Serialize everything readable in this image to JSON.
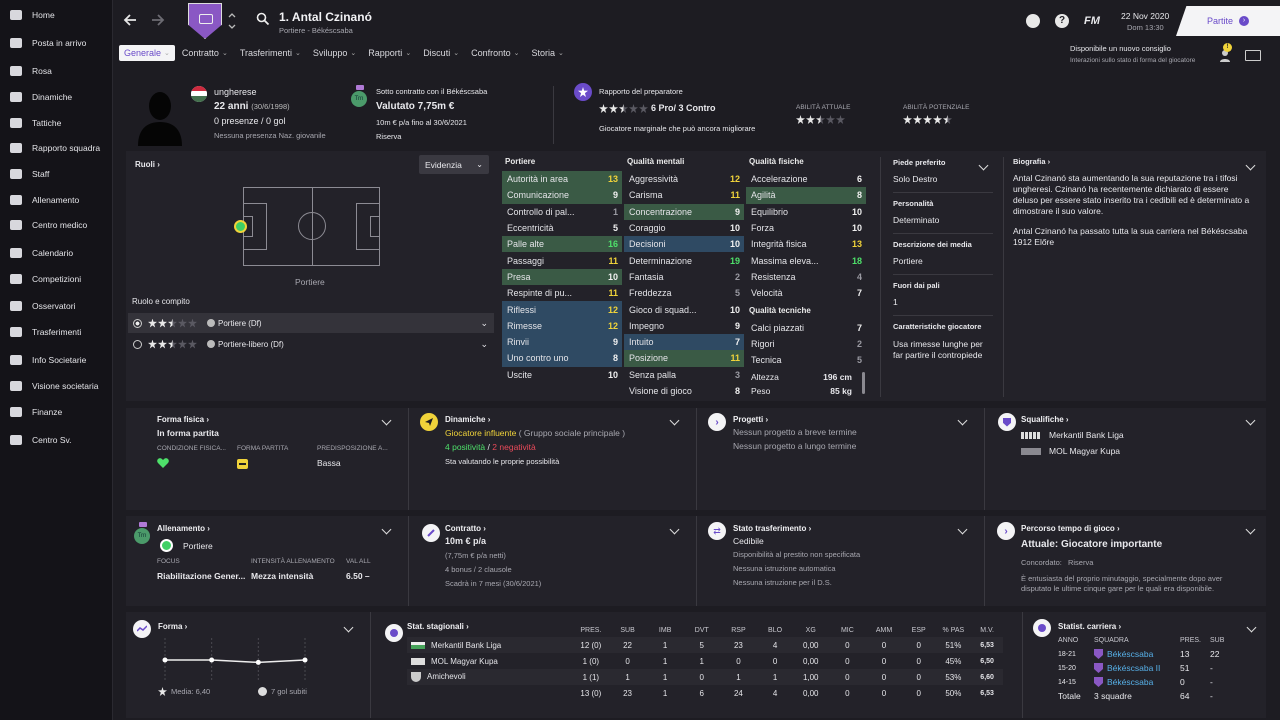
{
  "sidebar": {
    "items": [
      {
        "label": "Home",
        "icon": "home-icon"
      },
      {
        "label": "Posta in arrivo",
        "icon": "inbox-icon"
      },
      {
        "label": "Rosa",
        "icon": "shirt-icon"
      },
      {
        "label": "Dinamiche",
        "icon": "dynamics-icon"
      },
      {
        "label": "Tattiche",
        "icon": "tactics-icon"
      },
      {
        "label": "Rapporto squadra",
        "icon": "clipboard-icon"
      },
      {
        "label": "Staff",
        "icon": "staff-icon"
      },
      {
        "label": "Allenamento",
        "icon": "training-icon"
      },
      {
        "label": "Centro medico",
        "icon": "medical-icon"
      },
      {
        "label": "Calendario",
        "icon": "calendar-icon"
      },
      {
        "label": "Competizioni",
        "icon": "trophy-icon"
      },
      {
        "label": "Osservatori",
        "icon": "scout-icon"
      },
      {
        "label": "Trasferimenti",
        "icon": "transfer-icon"
      },
      {
        "label": "Info Societarie",
        "icon": "club-info-icon"
      },
      {
        "label": "Visione societaria",
        "icon": "vision-icon"
      },
      {
        "label": "Finanze",
        "icon": "finance-icon"
      },
      {
        "label": "Centro Sv.",
        "icon": "dev-centre-icon"
      }
    ]
  },
  "header": {
    "player_name": "1. Antal Czinanó",
    "subtitle": "Portiere - Békéscsaba",
    "date": "22 Nov 2020",
    "time": "Dom 13:30",
    "fm_logo": "FM",
    "continue_label": "Partite",
    "advice_title": "Disponibile un nuovo consiglio",
    "advice_sub": "Interazioni sullo stato di forma del giocatore",
    "advice_badge": "!"
  },
  "tabs": [
    {
      "label": "Generale",
      "active": true
    },
    {
      "label": "Contratto"
    },
    {
      "label": "Trasferimenti"
    },
    {
      "label": "Sviluppo"
    },
    {
      "label": "Rapporti"
    },
    {
      "label": "Discuti"
    },
    {
      "label": "Confronto"
    },
    {
      "label": "Storia"
    }
  ],
  "profile": {
    "nationality": "ungherese",
    "age": "22 anni",
    "dob": "(30/6/1998)",
    "caps": "0 presenze / 0 gol",
    "youth_caps": "Nessuna presenza Naz. giovanile",
    "contract_with": "Sotto contratto con il Békéscsaba",
    "value": "Valutato 7,75m €",
    "wage": "10m € p/a fino al 30/6/2021",
    "squad_status": "Riserva",
    "trn_badge": "Trn",
    "coach_report": "Rapporto del preparatore",
    "pros_cons": "6 Pro/ 3 Contro",
    "coach_summary": "Giocatore marginale che può ancora migliorare",
    "current_ability_label": "ABILITÀ ATTUALE",
    "potential_ability_label": "ABILITÀ POTENZIALE",
    "current_ability_stars": 2.5,
    "potential_ability_stars": 4.5
  },
  "roles": {
    "title": "Ruoli",
    "filter": "Evidenzia",
    "position_label": "Portiere",
    "role_duty_title": "Ruolo e compito",
    "items": [
      {
        "label": "Portiere (Df)",
        "stars": 2.5
      },
      {
        "label": "Portiere-libero (Df)",
        "stars": 2.5
      }
    ]
  },
  "attributes": {
    "goalkeeping_title": "Portiere",
    "mental_title": "Qualità mentali",
    "physical_title": "Qualità fisiche",
    "technical_title": "Qualità tecniche",
    "goalkeeping": [
      {
        "name": "Autorità in area",
        "value": "13",
        "hl": "g",
        "c": "yellow"
      },
      {
        "name": "Comunicazione",
        "value": "9",
        "hl": "g",
        "c": "white"
      },
      {
        "name": "Controllo di pal...",
        "value": "1",
        "hl": "",
        "c": "grey"
      },
      {
        "name": "Eccentricità",
        "value": "5",
        "hl": "",
        "c": "white"
      },
      {
        "name": "Palle alte",
        "value": "16",
        "hl": "g",
        "c": "green"
      },
      {
        "name": "Passaggi",
        "value": "11",
        "hl": "",
        "c": "yellow"
      },
      {
        "name": "Presa",
        "value": "10",
        "hl": "g",
        "c": "white"
      },
      {
        "name": "Respinte di pu...",
        "value": "11",
        "hl": "",
        "c": "yellow"
      },
      {
        "name": "Riflessi",
        "value": "12",
        "hl": "b",
        "c": "yellow"
      },
      {
        "name": "Rimesse",
        "value": "12",
        "hl": "b",
        "c": "yellow"
      },
      {
        "name": "Rinvii",
        "value": "9",
        "hl": "b",
        "c": "white"
      },
      {
        "name": "Uno contro uno",
        "value": "8",
        "hl": "b",
        "c": "white"
      },
      {
        "name": "Uscite",
        "value": "10",
        "hl": "",
        "c": "white"
      }
    ],
    "mental": [
      {
        "name": "Aggressività",
        "value": "12",
        "hl": "",
        "c": "yellow"
      },
      {
        "name": "Carisma",
        "value": "11",
        "hl": "",
        "c": "yellow"
      },
      {
        "name": "Concentrazione",
        "value": "9",
        "hl": "g",
        "c": "white"
      },
      {
        "name": "Coraggio",
        "value": "10",
        "hl": "",
        "c": "white"
      },
      {
        "name": "Decisioni",
        "value": "10",
        "hl": "b",
        "c": "white"
      },
      {
        "name": "Determinazione",
        "value": "19",
        "hl": "",
        "c": "green"
      },
      {
        "name": "Fantasia",
        "value": "2",
        "hl": "",
        "c": "grey"
      },
      {
        "name": "Freddezza",
        "value": "5",
        "hl": "",
        "c": "grey"
      },
      {
        "name": "Gioco di squad...",
        "value": "10",
        "hl": "",
        "c": "white"
      },
      {
        "name": "Impegno",
        "value": "9",
        "hl": "",
        "c": "white"
      },
      {
        "name": "Intuito",
        "value": "7",
        "hl": "b",
        "c": "white"
      },
      {
        "name": "Posizione",
        "value": "11",
        "hl": "g",
        "c": "yellow"
      },
      {
        "name": "Senza palla",
        "value": "3",
        "hl": "",
        "c": "grey"
      },
      {
        "name": "Visione di gioco",
        "value": "8",
        "hl": "",
        "c": "white"
      }
    ],
    "physical": [
      {
        "name": "Accelerazione",
        "value": "6",
        "hl": "",
        "c": "white"
      },
      {
        "name": "Agilità",
        "value": "8",
        "hl": "g",
        "c": "white"
      },
      {
        "name": "Equilibrio",
        "value": "10",
        "hl": "",
        "c": "white"
      },
      {
        "name": "Forza",
        "value": "10",
        "hl": "",
        "c": "white"
      },
      {
        "name": "Integrità fisica",
        "value": "13",
        "hl": "",
        "c": "yellow"
      },
      {
        "name": "Massima eleva...",
        "value": "18",
        "hl": "",
        "c": "green"
      },
      {
        "name": "Resistenza",
        "value": "4",
        "hl": "",
        "c": "grey"
      },
      {
        "name": "Velocità",
        "value": "7",
        "hl": "",
        "c": "white"
      }
    ],
    "technical": [
      {
        "name": "Calci piazzati",
        "value": "7",
        "hl": "",
        "c": "white"
      },
      {
        "name": "Rigori",
        "value": "2",
        "hl": "",
        "c": "grey"
      },
      {
        "name": "Tecnica",
        "value": "5",
        "hl": "",
        "c": "grey"
      }
    ],
    "height_label": "Altezza",
    "height": "196 cm",
    "weight_label": "Peso",
    "weight": "85 kg"
  },
  "info": {
    "foot_label": "Piede preferito",
    "foot": "Solo Destro",
    "personality_label": "Personalità",
    "personality": "Determinato",
    "media_label": "Descrizione dei media",
    "media": "Portiere",
    "away_label": "Fuori dai pali",
    "away": "1",
    "traits_label": "Caratteristiche giocatore",
    "traits": "Usa rimesse lunghe per far partire il contropiede"
  },
  "biography": {
    "title": "Biografia",
    "p1": "Antal Czinanó sta aumentando la sua reputazione tra i tifosi ungheresi. Czinanó ha recentemente dichiarato di essere deluso per essere stato inserito tra i cedibili ed è determinato a dimostrare il suo valore.",
    "p2": "Antal Czinanó ha passato tutta la sua carriera nel Békéscsaba 1912 Előre"
  },
  "cards": {
    "fitness": {
      "title": "Forma fisica",
      "value": "In forma partita",
      "col1": "CONDIZIONE FISICA...",
      "col2": "FORMA PARTITA",
      "col3": "PREDISPOSIZIONE A...",
      "val3": "Bassa"
    },
    "dynamics": {
      "title": "Dinamiche",
      "influence": "Giocatore influente",
      "group": "( Gruppo sociale principale )",
      "positive": "4 positività",
      "sep": "/",
      "negative": "2 negatività",
      "note": "Sta valutando le proprie possibilità"
    },
    "plans": {
      "title": "Progetti",
      "short": "Nessun progetto a breve termine",
      "long": "Nessun progetto a lungo termine"
    },
    "bans": {
      "title": "Squalifiche",
      "items": [
        "Merkantil Bank Liga",
        "MOL Magyar Kupa"
      ]
    },
    "training": {
      "title": "Allenamento",
      "role": "Portiere",
      "focus_label": "FOCUS",
      "intensity_label": "INTENSITÀ ALLENAMENTO",
      "val_label": "VAL ALL",
      "focus": "Riabilitazione Gener...",
      "intensity": "Mezza intensità",
      "val": "6.50",
      "dash": "–",
      "badge": "Trn"
    },
    "contract": {
      "title": "Contratto",
      "wage": "10m € p/a",
      "net": "(7,75m € p/a netti)",
      "bonus": "4 bonus / 2 clausole",
      "expiry": "Scadrà in 7 mesi (30/6/2021)"
    },
    "transfer": {
      "title": "Stato trasferimento",
      "status": "Cedibile",
      "l1": "Disponibilità al prestito non specificata",
      "l2": "Nessuna istruzione automatica",
      "l3": "Nessuna istruzione per il D.S."
    },
    "playing_time": {
      "title": "Percorso tempo di gioco",
      "current": "Attuale: Giocatore importante",
      "agreed": "Concordato:",
      "agreed_val": "Riserva",
      "note": "È entusiasta del proprio minutaggio, specialmente dopo aver disputato le ultime cinque gare per le quali era disponibile."
    },
    "form": {
      "title": "Forma",
      "average": "Media: 6,40",
      "conceded": "7 gol subiti"
    },
    "season_stats": {
      "title": "Stat. stagionali",
      "headers": [
        "PRES.",
        "SUB",
        "IMB",
        "DVT",
        "RSP",
        "BLO",
        "XG",
        "MIC",
        "AMM",
        "ESP",
        "% PAS",
        "M.V."
      ],
      "rows": [
        {
          "comp": "Merkantil Bank Liga",
          "vals": [
            "12 (0)",
            "22",
            "1",
            "5",
            "23",
            "4",
            "0,00",
            "0",
            "0",
            "0",
            "51%",
            "6,53"
          ]
        },
        {
          "comp": "MOL Magyar Kupa",
          "vals": [
            "1 (0)",
            "0",
            "1",
            "1",
            "0",
            "0",
            "0,00",
            "0",
            "0",
            "0",
            "45%",
            "6,50"
          ]
        },
        {
          "comp": "Amichevoli",
          "vals": [
            "1 (1)",
            "1",
            "1",
            "0",
            "1",
            "1",
            "1,00",
            "0",
            "0",
            "0",
            "53%",
            "6,60"
          ]
        },
        {
          "comp": "",
          "vals": [
            "13 (0)",
            "23",
            "1",
            "6",
            "24",
            "4",
            "0,00",
            "0",
            "0",
            "0",
            "50%",
            "6,53"
          ]
        }
      ]
    },
    "career": {
      "title": "Statist. carriera",
      "h_year": "ANNO",
      "h_team": "SQUADRA",
      "h_apps": "PRES.",
      "h_sub": "SUB",
      "rows": [
        {
          "year": "18-21",
          "team": "Békéscsaba",
          "apps": "13",
          "sub": "22"
        },
        {
          "year": "15-20",
          "team": "Békéscsaba II",
          "apps": "51",
          "sub": "-"
        },
        {
          "year": "14-15",
          "team": "Békéscsaba",
          "apps": "0",
          "sub": "-"
        }
      ],
      "total_label": "Totale",
      "total_teams": "3 squadre",
      "total_apps": "64",
      "total_sub": "-"
    }
  },
  "form_chart": {
    "ratings": [
      6.5,
      6.5,
      6.4,
      6.5
    ],
    "ylim": [
      5.5,
      7.5
    ]
  },
  "colors": {
    "accent": "#6a4bc9",
    "green": "#4ee06a",
    "yellow": "#f0d33a",
    "highlight_green": "#3a5a45",
    "highlight_blue": "#2f4a63"
  }
}
